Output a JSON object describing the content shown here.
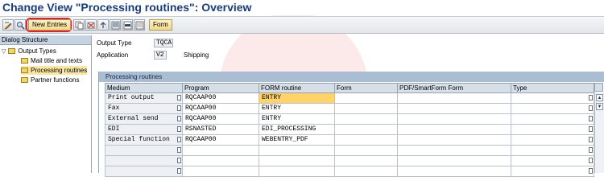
{
  "title": "Change View \"Processing routines\": Overview",
  "toolbar": {
    "new_entries_label": "New Entries",
    "form_label": "Form",
    "icons": [
      "display-change-icon",
      "find-icon",
      "copy-icon",
      "delete-icon",
      "undo-icon",
      "select-all-icon",
      "select-block-icon",
      "deselect-all-icon"
    ]
  },
  "dialog": {
    "header": "Dialog Structure",
    "items": [
      {
        "label": "Output Types",
        "level": 0,
        "expanded": true
      },
      {
        "label": "Mail title and texts",
        "level": 1
      },
      {
        "label": "Processing routines",
        "level": 1,
        "selected": true
      },
      {
        "label": "Partner functions",
        "level": 1
      }
    ]
  },
  "fields": {
    "output_type_label": "Output Type",
    "output_type_value": "TQCA",
    "application_label": "Application",
    "application_value": "V2",
    "application_text": "Shipping"
  },
  "table": {
    "title": "Processing routines",
    "columns": [
      "Medium",
      "Program",
      "FORM routine",
      "Form",
      "PDF/SmartForm Form",
      "Type"
    ],
    "rows": [
      [
        "Print output",
        "RQCAAP00",
        "ENTRY",
        "",
        "",
        ""
      ],
      [
        "Fax",
        "RQCAAP00",
        "ENTRY",
        "",
        "",
        ""
      ],
      [
        "External send",
        "RQCAAP00",
        "ENTRY",
        "",
        "",
        ""
      ],
      [
        "EDI",
        "RSNASTED",
        "EDI_PROCESSING",
        "",
        "",
        ""
      ],
      [
        "Special function",
        "RQCAAP00",
        "WEBENTRY_PDF",
        "",
        "",
        ""
      ],
      [
        "",
        "",
        "",
        "",
        "",
        ""
      ],
      [
        "",
        "",
        "",
        "",
        "",
        ""
      ],
      [
        "",
        "",
        "",
        "",
        "",
        ""
      ]
    ],
    "active_cell": {
      "row": 0,
      "col": 2
    }
  }
}
